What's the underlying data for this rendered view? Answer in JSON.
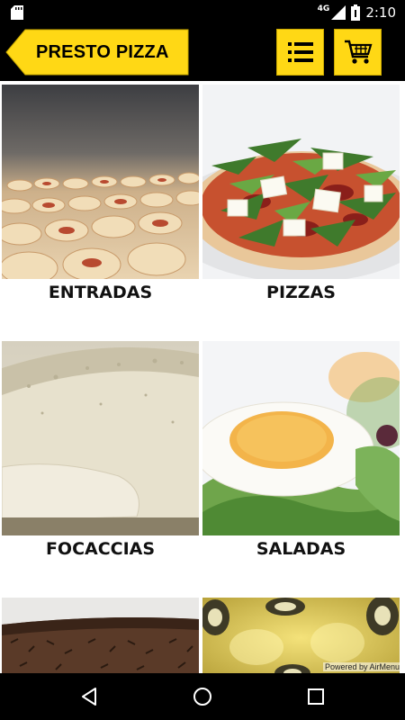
{
  "status_bar": {
    "network": "4G",
    "time": "2:10",
    "icons": [
      "sd-card-icon",
      "signal-icon",
      "battery-icon"
    ]
  },
  "header": {
    "brand_label": "PRESTO PIZZA",
    "icons": [
      "back-arrow-icon",
      "menu-icon",
      "cart-icon"
    ]
  },
  "colors": {
    "accent": "#FFD815",
    "bars": "#000000"
  },
  "categories": [
    {
      "label": "ENTRADAS",
      "photo": "appetizer-rolls-photo"
    },
    {
      "label": "PIZZAS",
      "photo": "pizza-arugula-photo"
    },
    {
      "label": "FOCACCIAS",
      "photo": "dough-photo"
    },
    {
      "label": "SALADAS",
      "photo": "egg-salad-photo"
    },
    {
      "label": "",
      "photo": "chocolate-dessert-photo"
    },
    {
      "label": "",
      "photo": "olive-oil-bottles-photo"
    }
  ],
  "footer": {
    "powered_by": "Powered by AirMenu"
  },
  "nav_bar": {
    "icons": [
      "back-icon",
      "home-icon",
      "recents-icon"
    ]
  }
}
